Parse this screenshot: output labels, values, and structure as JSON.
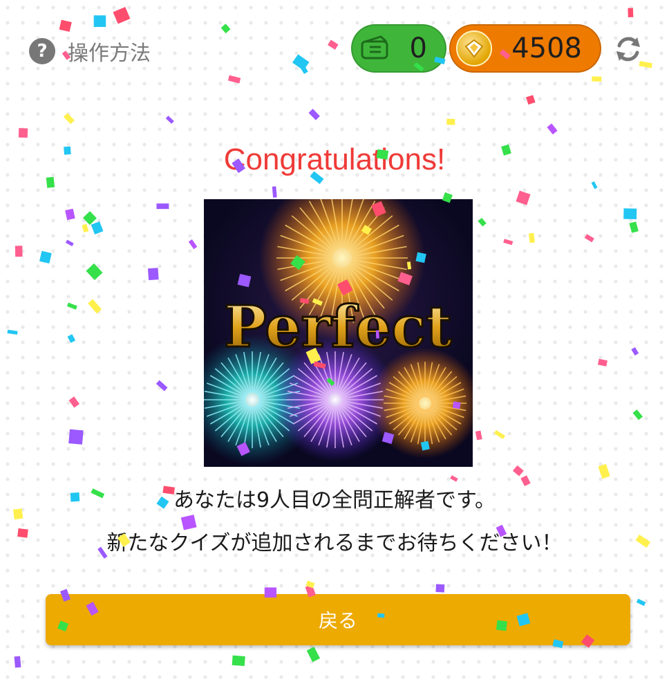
{
  "header": {
    "help_label": "操作方法",
    "tickets_value": "0",
    "coins_value": "4508"
  },
  "result": {
    "title": "Congratulations!",
    "badge_text": "Perfect",
    "message_rank": "あなたは9人目の全問正解者です。",
    "message_wait": "新たなクイズが追加されるまでお待ちください！"
  },
  "actions": {
    "back_label": "戻る"
  },
  "colors": {
    "ticket_pill": "#3fb63a",
    "coin_pill": "#ee7a00",
    "title": "#ef3a37",
    "back_button": "#edaa00"
  },
  "icons": [
    "help-icon",
    "ticket-icon",
    "coin-icon",
    "refresh-icon"
  ]
}
